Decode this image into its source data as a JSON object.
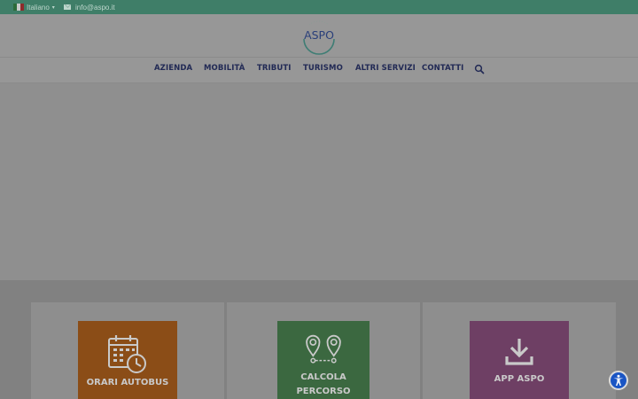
{
  "topbar": {
    "language": "Italiano",
    "email": "info@aspo.it"
  },
  "logo": {
    "text": "ASPO"
  },
  "nav": {
    "items": [
      "AZIENDA",
      "MOBILITÀ",
      "TRIBUTI",
      "TURISMO",
      "ALTRI SERVIZI",
      "CONTATTI"
    ]
  },
  "tiles": [
    {
      "label_lines": [
        "ORARI AUTOBUS"
      ],
      "color": "#8b4d17",
      "icon": "calendar-clock-icon"
    },
    {
      "label_lines": [
        "CALCOLA",
        "PERCORSO"
      ],
      "color": "#3b6840",
      "icon": "route-pins-icon"
    },
    {
      "label_lines": [
        "APP ASPO"
      ],
      "color": "#6e3f64",
      "icon": "download-icon"
    }
  ],
  "colors": {
    "topbar": "#3f7e68",
    "nav_text": "#222a55",
    "accessibility_button": "#1a55c4"
  }
}
